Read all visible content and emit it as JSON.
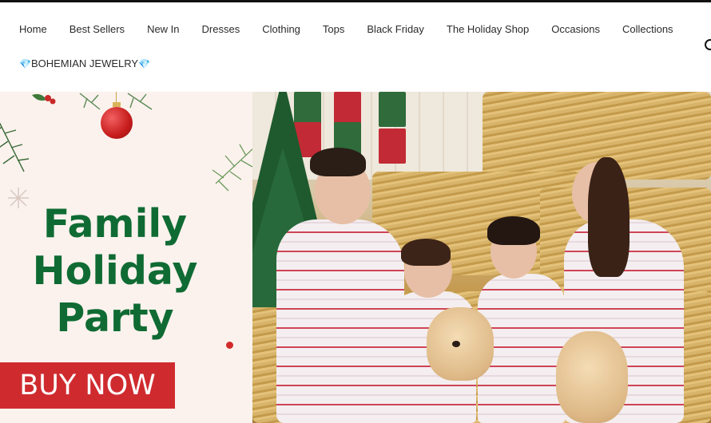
{
  "nav": {
    "row1": [
      "Home",
      "Best Sellers",
      "New In",
      "Dresses",
      "Clothing",
      "Tops",
      "Black Friday",
      "The Holiday Shop",
      "Occasions",
      "Collections"
    ],
    "row2": {
      "gem_left": "💎",
      "label": "BOHEMIAN JEWELRY",
      "gem_right": "💎"
    }
  },
  "hero": {
    "title_lines": [
      "Family",
      "Holiday",
      "Party"
    ],
    "cta_label": "BUY NOW"
  },
  "colors": {
    "title_green": "#0f6b33",
    "cta_red": "#cf2b2f",
    "promo_bg": "#fbf2ed"
  },
  "icons": [
    "search-icon",
    "gem-icon",
    "ornament-icon"
  ]
}
